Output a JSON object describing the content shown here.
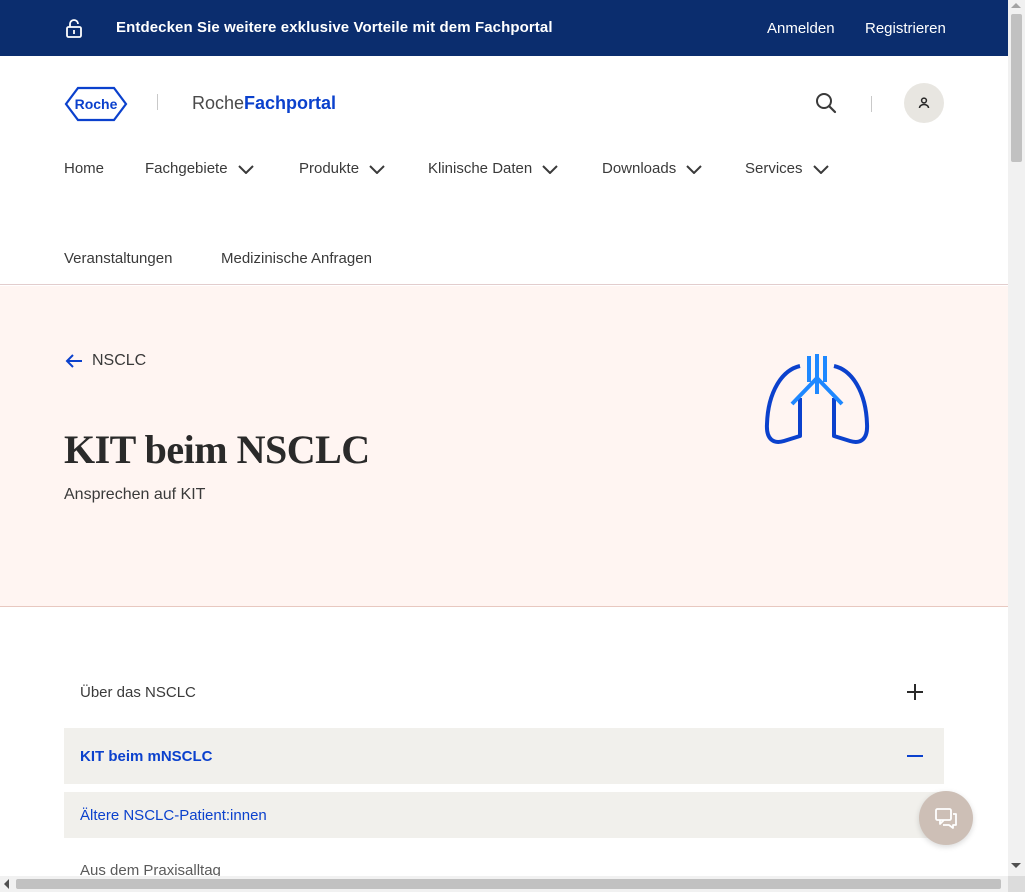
{
  "topbar": {
    "promo": "Entdecken Sie weitere exklusive Vorteile mit dem Fachportal",
    "login": "Anmelden",
    "register": "Registrieren",
    "icon": "unlock-icon"
  },
  "header": {
    "logo_text": "Roche",
    "brand_prefix": "Roche",
    "brand_name": "Fachportal",
    "icons": [
      "search-icon",
      "user-icon"
    ]
  },
  "nav": {
    "items": [
      {
        "label": "Home",
        "has_dropdown": false
      },
      {
        "label": "Fachgebiete",
        "has_dropdown": true
      },
      {
        "label": "Produkte",
        "has_dropdown": true
      },
      {
        "label": "Klinische Daten",
        "has_dropdown": true
      },
      {
        "label": "Downloads",
        "has_dropdown": true
      },
      {
        "label": "Services",
        "has_dropdown": true
      },
      {
        "label": "Veranstaltungen",
        "has_dropdown": false
      },
      {
        "label": "Medizinische Anfragen",
        "has_dropdown": false
      }
    ]
  },
  "hero": {
    "back_label": "NSCLC",
    "title": "KIT beim NSCLC",
    "subtitle": "Ansprechen auf KIT",
    "illustration": "lungs-icon"
  },
  "accordion": {
    "items": [
      {
        "label": "Über das NSCLC",
        "state": "collapsed"
      },
      {
        "label": "KIT beim mNSCLC",
        "state": "expanded"
      },
      {
        "label": "Ältere NSCLC-Patient:innen",
        "state": "active-subitem"
      },
      {
        "label": "Aus dem Praxisalltag",
        "state": "subitem"
      }
    ]
  },
  "colors": {
    "topbar": "#0b2d6e",
    "accent": "#0b41cd",
    "hero_bg": "#fff5f2",
    "accordion_active_bg": "#f1f0ec",
    "chat_button": "#cdbfb6"
  }
}
